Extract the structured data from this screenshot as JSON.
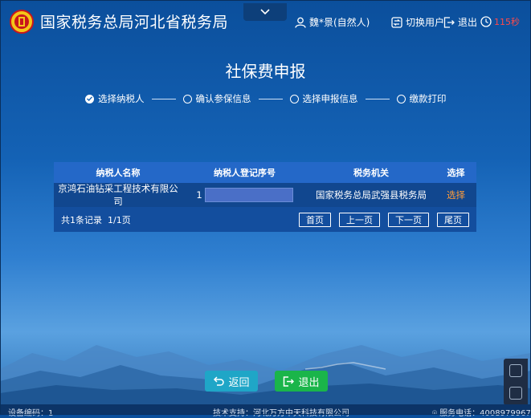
{
  "header": {
    "site_title": "国家税务总局河北省税务局",
    "user_name": "魏*景(自然人)",
    "switch_user": "切换用户",
    "logout": "退出",
    "countdown": "115秒"
  },
  "page_title": "社保费申报",
  "steps": [
    {
      "label": "选择纳税人",
      "done": true
    },
    {
      "label": "确认参保信息",
      "done": false
    },
    {
      "label": "选择申报信息",
      "done": false
    },
    {
      "label": "缴款打印",
      "done": false
    }
  ],
  "table": {
    "headers": [
      "纳税人名称",
      "纳税人登记序号",
      "税务机关",
      "选择"
    ],
    "rows": [
      {
        "name": "京鸿石油钻采工程技术有限公司",
        "reg_prefix": "1",
        "office": "国家税务总局武强县税务局",
        "action": "选择"
      }
    ],
    "summary": "共1条记录  1/1页",
    "pager": {
      "first": "首页",
      "prev": "上一页",
      "next": "下一页",
      "last": "尾页"
    }
  },
  "buttons": {
    "back": "返回",
    "exit": "退出"
  },
  "footer": {
    "device": "设备编码：1",
    "support": "技术支持：河北万方中天科技有限公司",
    "phone": "服务电话：4008979967"
  },
  "colors": {
    "countdown": "#ff4a4a",
    "select_link": "#ff9c3a",
    "back_button": "#1fa6c7",
    "exit_button": "#1ab54a"
  }
}
